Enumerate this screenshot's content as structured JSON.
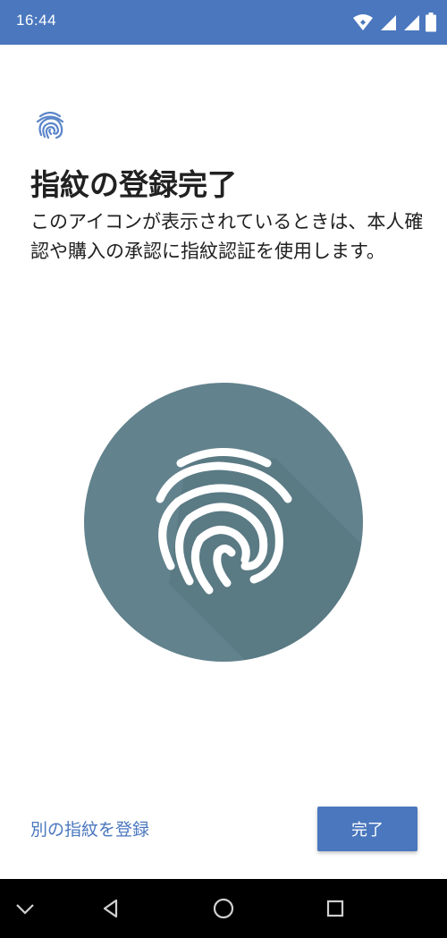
{
  "status_bar": {
    "time": "16:44",
    "background_color": "#4a77be",
    "icons": [
      "wifi-icon",
      "signal-icon",
      "signal-icon",
      "battery-icon"
    ]
  },
  "header": {
    "icon": "fingerprint-icon",
    "title": "指紋の登録完了",
    "description": "このアイコンが表示されているときは、本人確認や購入の承認に指紋認証を使用します。"
  },
  "hero": {
    "icon": "fingerprint-icon",
    "circle_color": "#62828d"
  },
  "actions": {
    "add_another_label": "別の指紋を登録",
    "done_label": "完了",
    "accent_color": "#4a77be"
  },
  "nav_bar": {
    "items": [
      "chevron-down-icon",
      "back-icon",
      "home-icon",
      "recents-icon"
    ]
  }
}
